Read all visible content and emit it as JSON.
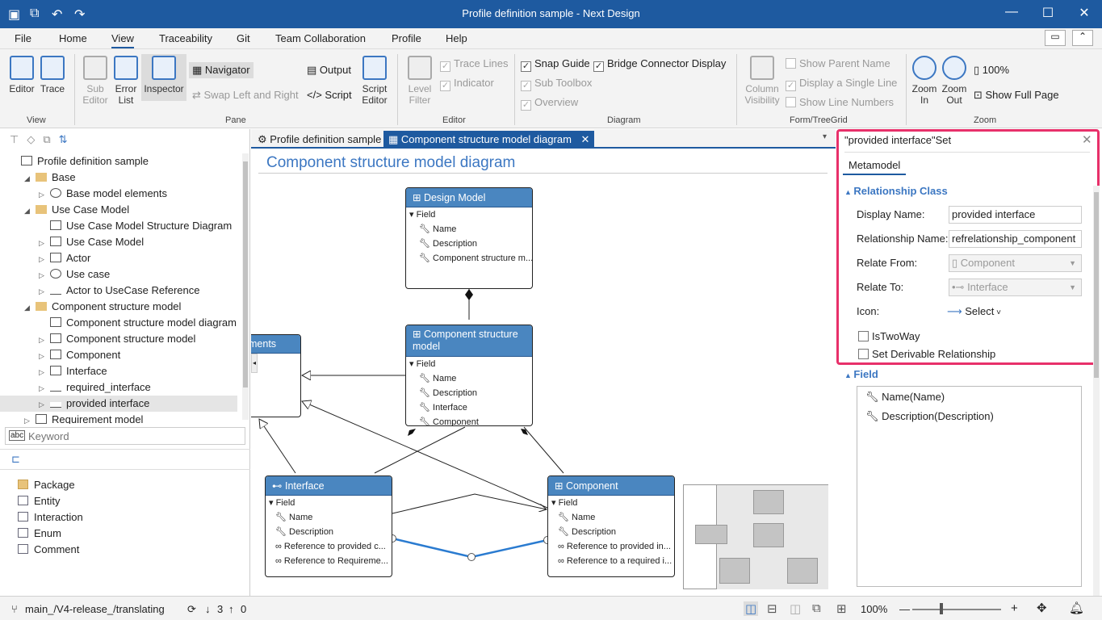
{
  "window": {
    "title": "Profile definition sample - Next Design"
  },
  "menu": [
    "File",
    "Home",
    "View",
    "Traceability",
    "Git",
    "Team Collaboration",
    "Profile",
    "Help"
  ],
  "menu_active": "View",
  "ribbon": {
    "view": {
      "editor": "Editor",
      "trace": "Trace",
      "group": "View"
    },
    "pane": {
      "sub_editor": "Sub\nEditor",
      "error_list": "Error\nList",
      "inspector": "Inspector",
      "navigator": "Navigator",
      "swap": "Swap Left and Right",
      "output": "Output",
      "script": "Script",
      "script_editor": "Script\nEditor",
      "group": "Pane"
    },
    "editor": {
      "level_filter": "Level\nFilter",
      "trace_lines": "Trace Lines",
      "indicator": "Indicator",
      "group": "Editor"
    },
    "diagram": {
      "snap_guide": "Snap Guide",
      "bridge": "Bridge Connector Display",
      "sub_toolbox": "Sub Toolbox",
      "overview": "Overview",
      "group": "Diagram"
    },
    "form": {
      "column_visibility": "Column\nVisibility",
      "show_parent": "Show Parent Name",
      "single_line": "Display a Single Line",
      "line_numbers": "Show Line Numbers",
      "group": "Form/TreeGrid"
    },
    "zoom": {
      "zoom_in": "Zoom\nIn",
      "zoom_out": "Zoom\nOut",
      "percent": "100%",
      "full_page": "Show Full Page",
      "group": "Zoom"
    }
  },
  "tree": [
    {
      "label": "Profile definition sample",
      "level": 0,
      "arrow": "",
      "kind": "model"
    },
    {
      "label": "Base",
      "level": 1,
      "arrow": "◢",
      "kind": "folder"
    },
    {
      "label": "Base model elements",
      "level": 2,
      "arrow": "▷",
      "kind": "circle"
    },
    {
      "label": "Use Case Model",
      "level": 1,
      "arrow": "◢",
      "kind": "folder"
    },
    {
      "label": "Use Case Model Structure Diagram",
      "level": 2,
      "arrow": "",
      "kind": "diagram"
    },
    {
      "label": "Use Case Model",
      "level": 2,
      "arrow": "▷",
      "kind": "class"
    },
    {
      "label": "Actor",
      "level": 2,
      "arrow": "▷",
      "kind": "actor"
    },
    {
      "label": "Use case",
      "level": 2,
      "arrow": "▷",
      "kind": "oval"
    },
    {
      "label": "Actor to UseCase Reference",
      "level": 2,
      "arrow": "▷",
      "kind": "arrow"
    },
    {
      "label": "Component structure model",
      "level": 1,
      "arrow": "◢",
      "kind": "folder"
    },
    {
      "label": "Component structure model diagram",
      "level": 2,
      "arrow": "",
      "kind": "diagram"
    },
    {
      "label": "Component structure model",
      "level": 2,
      "arrow": "▷",
      "kind": "class"
    },
    {
      "label": "Component",
      "level": 2,
      "arrow": "▷",
      "kind": "class"
    },
    {
      "label": "Interface",
      "level": 2,
      "arrow": "▷",
      "kind": "iface"
    },
    {
      "label": "required_interface",
      "level": 2,
      "arrow": "▷",
      "kind": "arrow"
    },
    {
      "label": "provided interface",
      "level": 2,
      "arrow": "▷",
      "kind": "arrow",
      "selected": true
    },
    {
      "label": "Requirement model",
      "level": 1,
      "arrow": "▷",
      "kind": "grid"
    }
  ],
  "search": {
    "placeholder": "Keyword"
  },
  "palette": [
    "Package",
    "Entity",
    "Interaction",
    "Enum",
    "Comment"
  ],
  "tabs": [
    {
      "label": "Profile definition sample"
    },
    {
      "label": "Component structure model diagram",
      "active": true
    }
  ],
  "diagram": {
    "title": "Component structure model diagram",
    "nodes": {
      "design": {
        "title": "Design Model",
        "section": "Field",
        "fields": [
          "Name",
          "Description",
          "Component structure m..."
        ]
      },
      "csm": {
        "title": "Component structure model",
        "section": "Field",
        "fields": [
          "Name",
          "Description",
          "Interface",
          "Component"
        ]
      },
      "elements": {
        "title": "ments"
      },
      "iface": {
        "title": "Interface",
        "section": "Field",
        "fields": [
          "Name",
          "Description",
          "Reference to provided c...",
          "Reference to Requireme..."
        ]
      },
      "comp": {
        "title": "Component",
        "section": "Field",
        "fields": [
          "Name",
          "Description",
          "Reference to provided in...",
          "Reference to a required i..."
        ]
      }
    }
  },
  "inspector": {
    "title": "\"provided interface\"Set",
    "tab": "Metamodel",
    "section": "Relationship Class",
    "display_name_label": "Display Name:",
    "display_name": "provided interface",
    "rel_name_label": "Relationship Name:",
    "rel_name": "refrelationship_component",
    "relate_from_label": "Relate From:",
    "relate_from": "Component",
    "relate_to_label": "Relate To:",
    "relate_to": "Interface",
    "icon_label": "Icon:",
    "icon_value": "Select",
    "is_two_way": "IsTwoWay",
    "derivable": "Set Derivable Relationship",
    "field_section": "Field",
    "fields": [
      "Name(Name)",
      "Description(Description)"
    ],
    "highlight_color": "#e8306a"
  },
  "status": {
    "branch": "main_/V4-release_/translating",
    "down": "3",
    "up": "0",
    "zoom": "100%"
  }
}
